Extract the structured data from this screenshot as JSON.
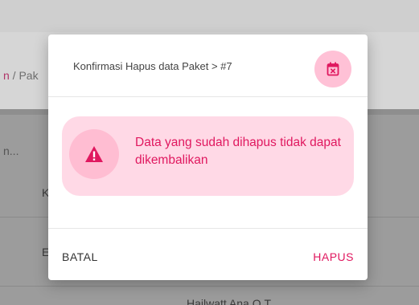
{
  "background": {
    "breadcrumb_link": "n",
    "breadcrumb_sep": " / ",
    "breadcrumb_page": "Pak",
    "search_placeholder_fragment": "n...",
    "row_letter_1": "K",
    "row_letter_2": "E",
    "row_text_bottom": "Hailwatt Ana  O.T."
  },
  "modal": {
    "title": "Konfirmasi Hapus data Paket > #7",
    "header_icon": "calendar-remove-icon",
    "alert": {
      "icon": "warning-triangle-icon",
      "message": "Data yang sudah dihapus tidak dapat dikembalikan"
    },
    "cancel_label": "BATAL",
    "delete_label": "HAPUS"
  },
  "colors": {
    "accent": "#e0185f",
    "icon_bg": "#ffc1d6",
    "alert_bg": "#ffd9e6",
    "overlay": "#8e8e8e"
  }
}
